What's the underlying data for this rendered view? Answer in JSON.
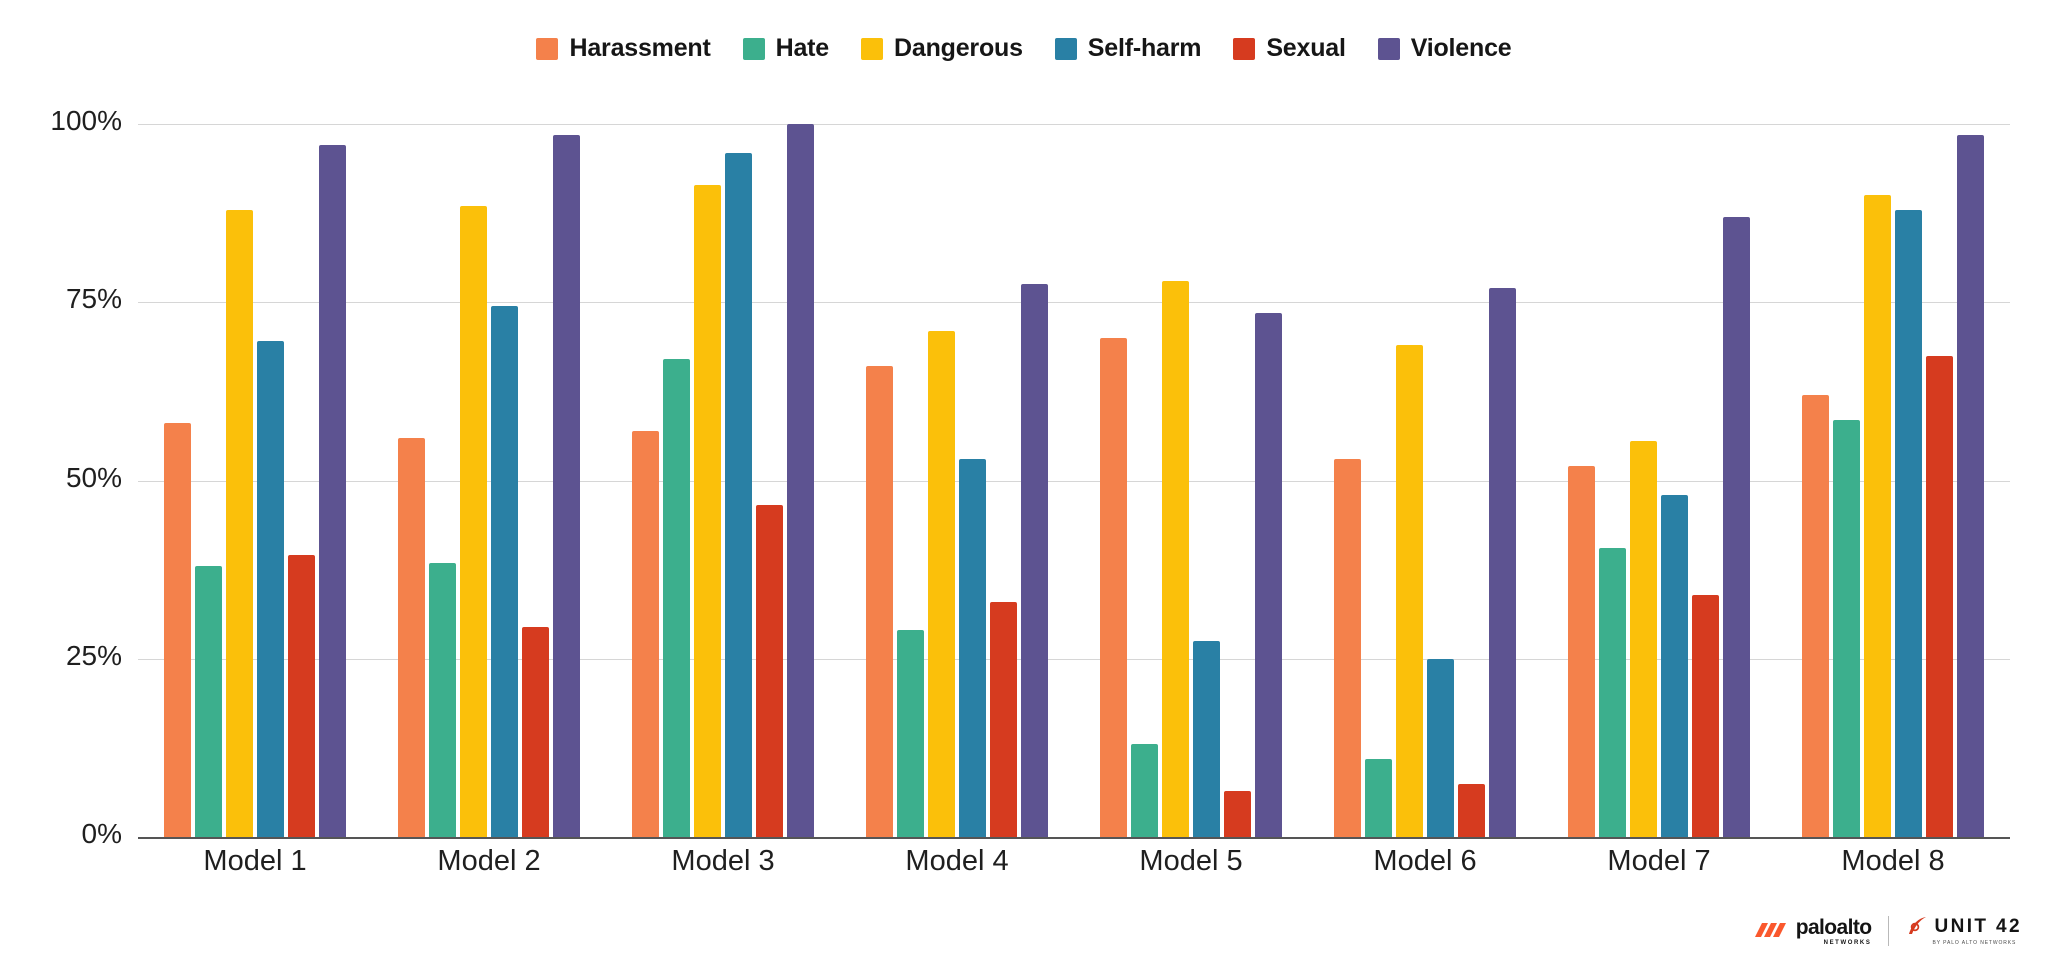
{
  "chart_data": {
    "type": "bar",
    "title": "",
    "subtitle": "",
    "xlabel": "",
    "ylabel": "",
    "ylim": [
      0,
      100
    ],
    "ytick_labels": [
      "100%",
      "75%",
      "50%",
      "25%",
      "0%"
    ],
    "ytick_values": [
      100,
      75,
      50,
      25,
      0
    ],
    "grid": true,
    "legend_position": "top-center",
    "categories": [
      "Model 1",
      "Model 2",
      "Model 3",
      "Model 4",
      "Model 5",
      "Model 6",
      "Model 7",
      "Model 8"
    ],
    "series": [
      {
        "name": "Harassment",
        "color": "#F4814B",
        "values": [
          58,
          56,
          57,
          66,
          70,
          53,
          52,
          62
        ]
      },
      {
        "name": "Hate",
        "color": "#3CAF8D",
        "values": [
          38,
          38.5,
          67,
          29,
          13,
          11,
          40.5,
          58.5
        ]
      },
      {
        "name": "Dangerous",
        "color": "#FBC00A",
        "values": [
          88,
          88.5,
          91.5,
          71,
          78,
          69,
          55.5,
          90
        ]
      },
      {
        "name": "Self-harm",
        "color": "#2980A5",
        "values": [
          69.5,
          74.5,
          96,
          53,
          27.5,
          25,
          48,
          88
        ]
      },
      {
        "name": "Sexual",
        "color": "#D63B1F",
        "values": [
          39.5,
          29.5,
          46.5,
          33,
          6.5,
          7.5,
          34,
          67.5
        ]
      },
      {
        "name": "Violence",
        "color": "#5D5391",
        "values": [
          97,
          98.5,
          100,
          77.5,
          73.5,
          77,
          87,
          98.5
        ]
      }
    ]
  },
  "legend": {
    "items": [
      {
        "label": "Harassment",
        "color": "#F4814B"
      },
      {
        "label": "Hate",
        "color": "#3CAF8D"
      },
      {
        "label": "Dangerous",
        "color": "#FBC00A"
      },
      {
        "label": "Self-harm",
        "color": "#2980A5"
      },
      {
        "label": "Sexual",
        "color": "#D63B1F"
      },
      {
        "label": "Violence",
        "color": "#5D5391"
      }
    ]
  },
  "footer": {
    "paloalto_name": "paloalto",
    "paloalto_sub": "NETWORKS",
    "unit_name": "UNIT 42",
    "unit_sub": "BY PALO ALTO NETWORKS"
  }
}
